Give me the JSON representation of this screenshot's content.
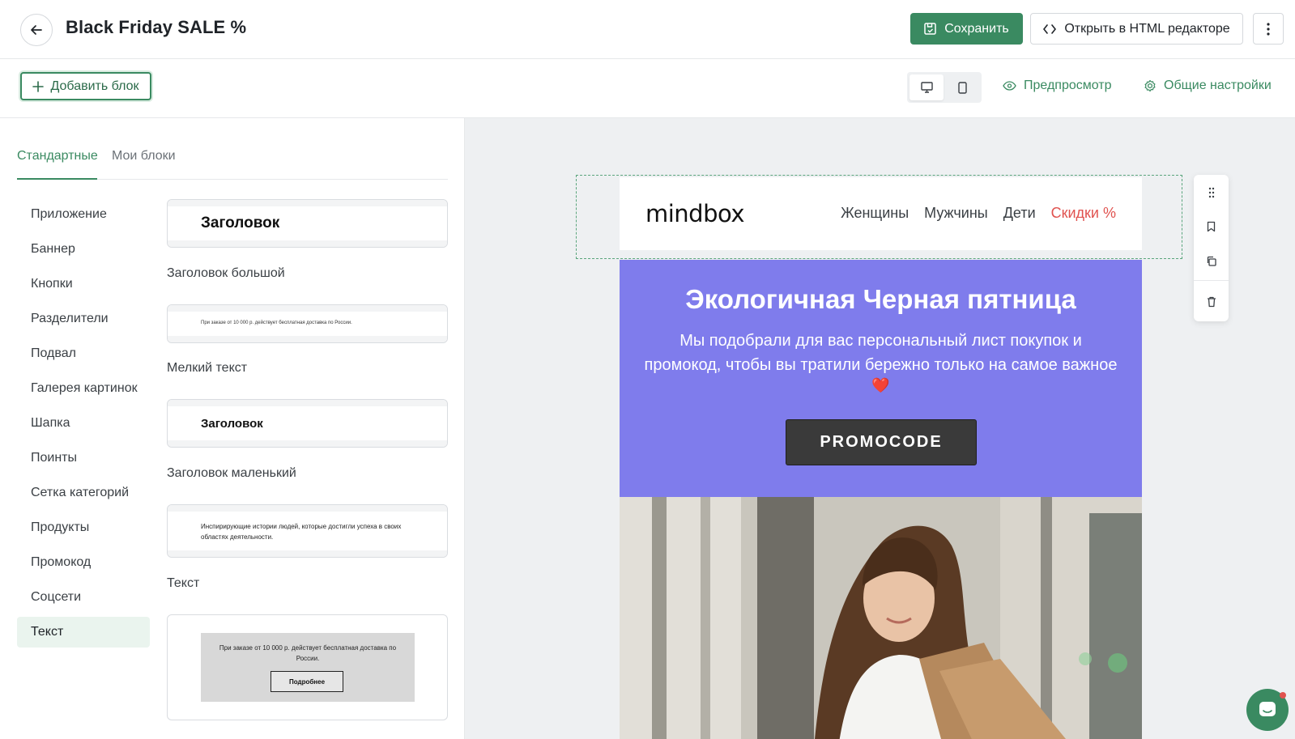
{
  "header": {
    "title": "Black Friday SALE %",
    "save_label": "Сохранить",
    "html_editor_label": "Открыть в HTML редакторе"
  },
  "toolbar": {
    "add_block_label": "Добавить блок",
    "preview_label": "Предпросмотр",
    "settings_label": "Общие настройки",
    "device_selected": "desktop"
  },
  "left_panel": {
    "tabs": [
      {
        "label": "Стандартные",
        "active": true
      },
      {
        "label": "Мои блоки",
        "active": false
      }
    ],
    "categories": [
      {
        "label": "Приложение"
      },
      {
        "label": "Баннер"
      },
      {
        "label": "Кнопки"
      },
      {
        "label": "Разделители"
      },
      {
        "label": "Подвал"
      },
      {
        "label": "Галерея картинок"
      },
      {
        "label": "Шапка"
      },
      {
        "label": "Поинты"
      },
      {
        "label": "Сетка категорий"
      },
      {
        "label": "Продукты"
      },
      {
        "label": "Промокод"
      },
      {
        "label": "Соцсети"
      },
      {
        "label": "Текст",
        "active": true
      }
    ],
    "blocks": [
      {
        "preview_text": "Заголовок",
        "label": "Заголовок большой"
      },
      {
        "preview_text": "При заказе от 10 000 р. действует бесплатная доставка по России.",
        "label": "Мелкий текст"
      },
      {
        "preview_text": "Заголовок",
        "label": "Заголовок маленький"
      },
      {
        "preview_text": "Инспирирующие истории людей, которые достигли успеха в своих областях деятельности.",
        "label": "Текст"
      },
      {
        "preview_text": "При заказе от 10 000 р. действует бесплатная доставка по России.",
        "button_text": "Подробнее"
      }
    ]
  },
  "email": {
    "logo": "mindbox",
    "nav": [
      "Женщины",
      "Мужчины",
      "Дети"
    ],
    "nav_sale": "Скидки %",
    "hero_title": "Экологичная Черная пятница",
    "hero_text": "Мы подобрали для вас персональный лист покупок и промокод, чтобы вы тратили бережно только на самое важное",
    "heart": "❤️",
    "promo_button": "PROMOCODE",
    "hero_bg": "#7f7cec",
    "sale_color": "#e0524f"
  },
  "colors": {
    "accent": "#3a8a61"
  }
}
